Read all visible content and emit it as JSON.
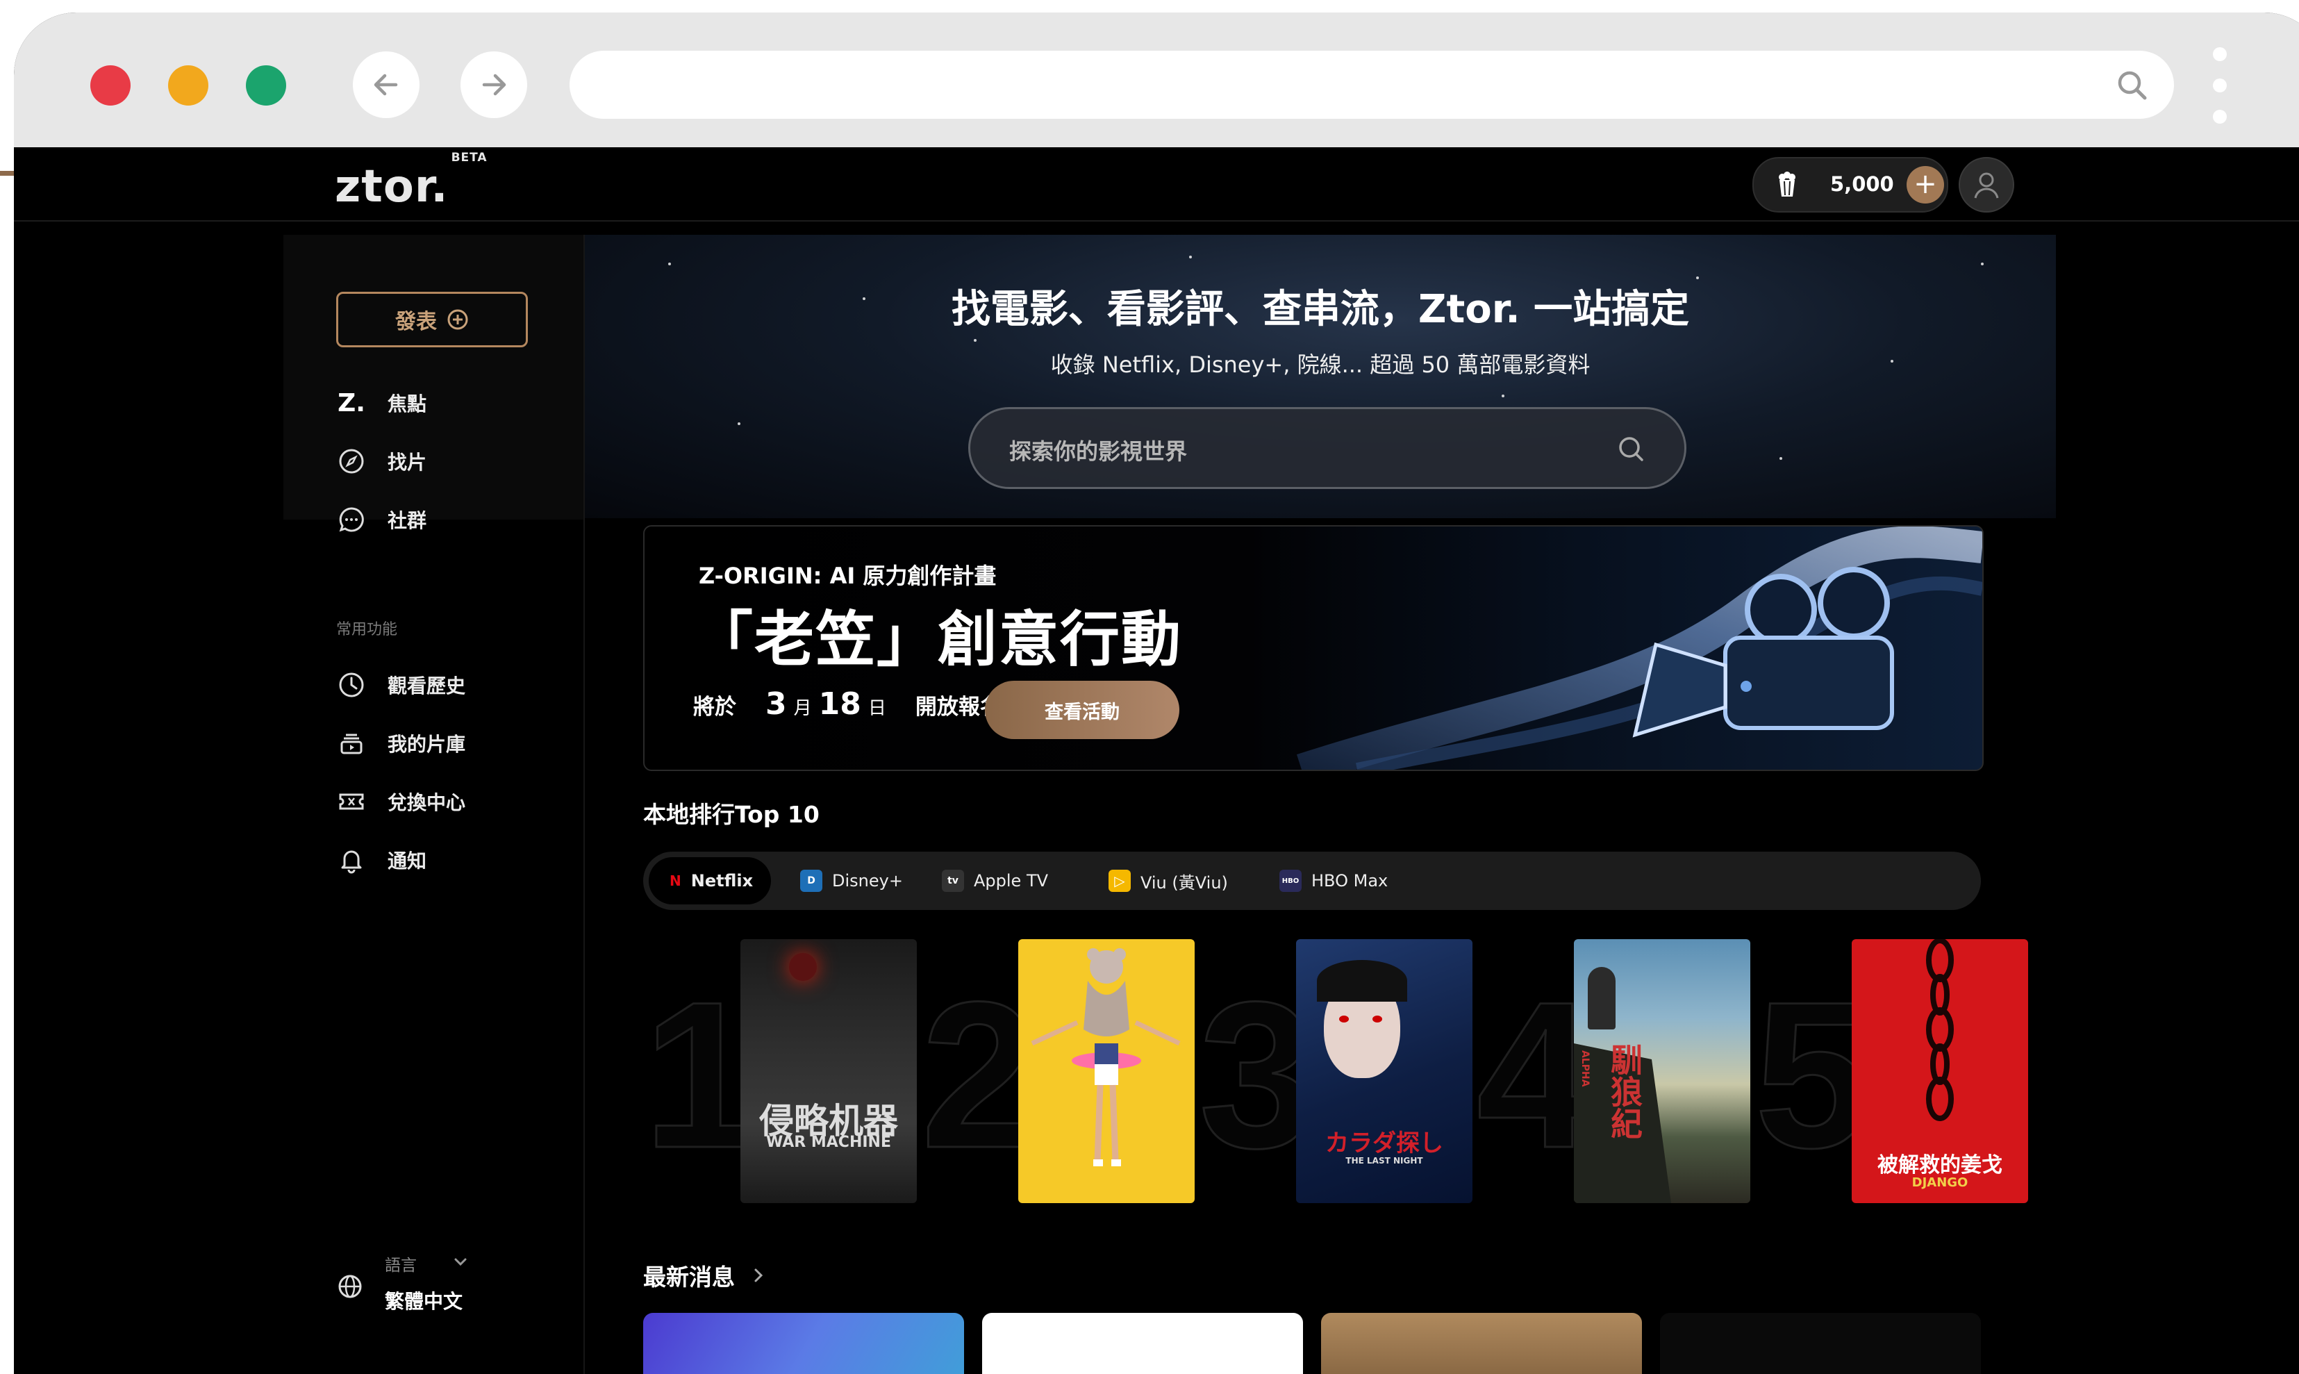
{
  "app": {
    "logo": "ztor.",
    "logo_badge": "BETA",
    "coins": "5,000",
    "coin_add": "+"
  },
  "sidebar": {
    "post_button": "發表",
    "nav": [
      {
        "label": "焦點",
        "icon": "ztor-z-icon"
      },
      {
        "label": "找片",
        "icon": "compass-icon"
      },
      {
        "label": "社群",
        "icon": "chat-bubble-icon"
      }
    ],
    "section_label": "常用功能",
    "tools": [
      {
        "label": "觀看歷史",
        "icon": "clock-icon"
      },
      {
        "label": "我的片庫",
        "icon": "library-icon"
      },
      {
        "label": "兌換中心",
        "icon": "ticket-icon"
      },
      {
        "label": "通知",
        "icon": "bell-icon"
      }
    ],
    "language_label": "語言",
    "language_value": "繁體中文"
  },
  "hero": {
    "title": "找電影、看影評、查串流，Ztor. 一站搞定",
    "subtitle": "收錄 Netflix, Disney+, 院線... 超過 50 萬部電影資料",
    "search_placeholder": "探索你的影視世界"
  },
  "banner": {
    "label": "Z-ORIGIN:  AI 原力創作計畫",
    "title": "「老笠」創意行動",
    "date_prefix": "將於",
    "month": "3",
    "month_unit": "月",
    "day": "18",
    "day_unit": "日",
    "date_suffix": "開放報名",
    "button": "查看活動"
  },
  "rankings": {
    "title": "本地排行Top 10",
    "tabs": [
      {
        "label": "Netflix",
        "icon": "N",
        "color": "#e50914",
        "active": true
      },
      {
        "label": "Disney+",
        "icon": "D",
        "color": "#1e6fb7",
        "active": false
      },
      {
        "label": "Apple TV",
        "icon": "tv",
        "color": "#333333",
        "active": false
      },
      {
        "label": "Viu (黃Viu)",
        "icon": "▷",
        "color": "#f5b800",
        "active": false
      },
      {
        "label": "HBO Max",
        "icon": "HBO",
        "color": "#2a2a5a",
        "active": false
      }
    ],
    "items": [
      {
        "rank": "1",
        "caption": "侵略机器",
        "caption_sub": "WAR MACHINE"
      },
      {
        "rank": "2",
        "caption": "",
        "caption_sub": ""
      },
      {
        "rank": "3",
        "caption": "カラダ探し",
        "caption_sub": "THE LAST NIGHT"
      },
      {
        "rank": "4",
        "caption": "馴狼紀",
        "caption_sub": "ALPHA"
      },
      {
        "rank": "5",
        "caption": "被解救的姜戈",
        "caption_sub": "DJANGO"
      }
    ]
  },
  "news": {
    "title": "最新消息",
    "more_icon": "chevron-right-icon"
  }
}
